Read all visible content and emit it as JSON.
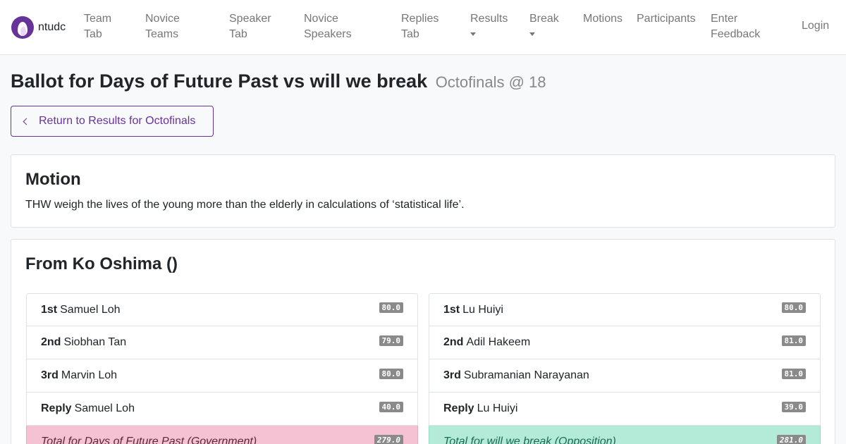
{
  "nav": {
    "brand": "ntudc",
    "items": [
      {
        "label": "Team Tab",
        "lines": [
          "Team",
          "Tab"
        ],
        "dropdown": false
      },
      {
        "label": "Novice Teams",
        "lines": [
          "Novice",
          "Teams"
        ],
        "dropdown": false
      },
      {
        "label": "Speaker Tab",
        "lines": [
          "Speaker",
          "Tab"
        ],
        "dropdown": false
      },
      {
        "label": "Novice Speakers",
        "lines": [
          "Novice",
          "Speakers"
        ],
        "dropdown": false
      },
      {
        "label": "Replies Tab",
        "lines": [
          "Replies",
          "Tab"
        ],
        "dropdown": false
      },
      {
        "label": "Results",
        "lines": [
          "Results"
        ],
        "dropdown": true
      },
      {
        "label": "Break",
        "lines": [
          "Break"
        ],
        "dropdown": true
      },
      {
        "label": "Motions",
        "lines": [
          "Motions"
        ],
        "dropdown": false
      },
      {
        "label": "Participants",
        "lines": [
          "Participants"
        ],
        "dropdown": false
      },
      {
        "label": "Enter Feedback",
        "lines": [
          "Enter",
          "Feedback"
        ],
        "dropdown": false
      }
    ],
    "login": "Login"
  },
  "page": {
    "title": "Ballot for Days of Future Past vs will we break",
    "subtitle": "Octofinals @ 18",
    "back_button": "Return to Results for Octofinals"
  },
  "motion": {
    "heading": "Motion",
    "text": "THW weigh the lives of the young more than the elderly in calculations of ‘statistical life’."
  },
  "ballot": {
    "heading": "From Ko Oshima ()",
    "teams": [
      {
        "side": "gov",
        "speakers": [
          {
            "position": "1st",
            "name": "Samuel Loh",
            "score": "80.0"
          },
          {
            "position": "2nd",
            "name": "Siobhan Tan",
            "score": "79.0"
          },
          {
            "position": "3rd",
            "name": "Marvin Loh",
            "score": "80.0"
          },
          {
            "position": "Reply",
            "name": "Samuel Loh",
            "score": "40.0"
          }
        ],
        "total_label": "Total for Days of Future Past (Government)",
        "total": "279.0",
        "total_color": "#f4c2d3"
      },
      {
        "side": "opp",
        "speakers": [
          {
            "position": "1st",
            "name": "Lu Huiyi",
            "score": "80.0"
          },
          {
            "position": "2nd",
            "name": "Adil Hakeem",
            "score": "81.0"
          },
          {
            "position": "3rd",
            "name": "Subramanian Narayanan",
            "score": "81.0"
          },
          {
            "position": "Reply",
            "name": "Lu Huiyi",
            "score": "39.0"
          }
        ],
        "total_label": "Total for will we break (Opposition)",
        "total": "281.0",
        "total_color": "#b3ead8"
      }
    ]
  },
  "colors": {
    "brand": "#663399",
    "badge": "#8a8a8a"
  },
  "icons": {
    "logo": "tabbycat-flame-logo",
    "back": "chevron-left-icon",
    "dropdown": "caret-down-icon"
  }
}
